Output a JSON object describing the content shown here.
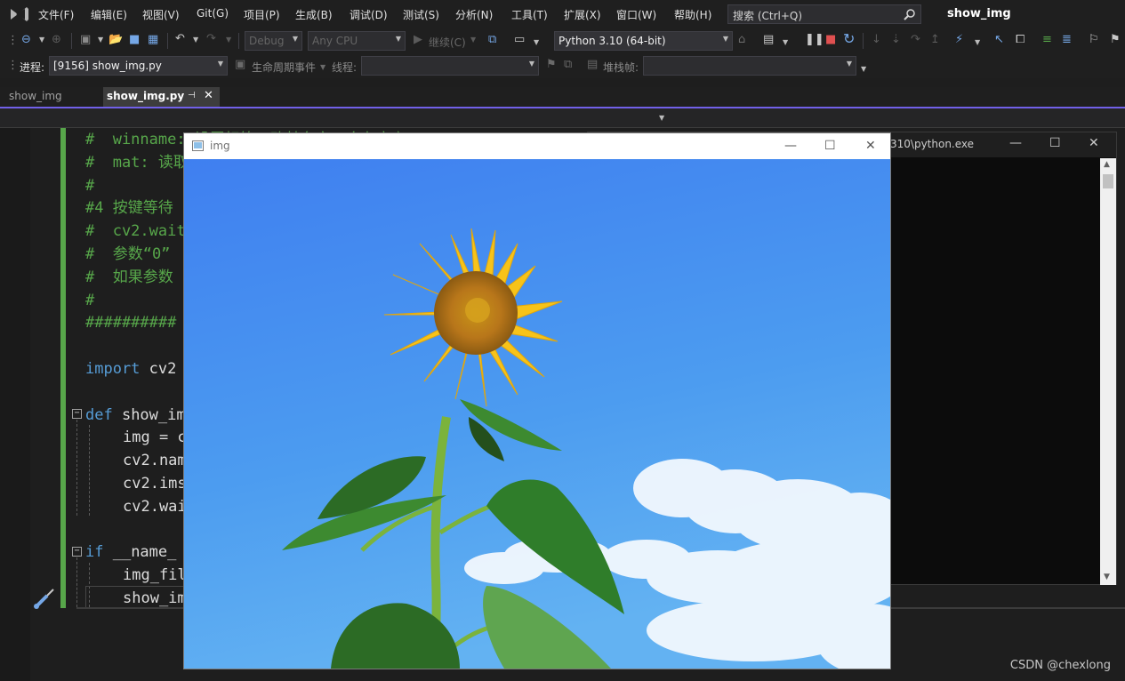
{
  "menubar": {
    "items": [
      "文件(F)",
      "编辑(E)",
      "视图(V)",
      "Git(G)",
      "项目(P)",
      "生成(B)",
      "调试(D)",
      "测试(S)",
      "分析(N)",
      "工具(T)",
      "扩展(X)",
      "窗口(W)",
      "帮助(H)"
    ],
    "search_placeholder": "搜索 (Ctrl+Q)",
    "app_title": "show_img"
  },
  "toolbar": {
    "config": "Debug",
    "platform": "Any CPU",
    "continue_label": "继续(C)",
    "environment": "Python 3.10 (64-bit)"
  },
  "debug_bar": {
    "process_label": "进程:",
    "process_value": "[9156] show_img.py",
    "lifecycle_label": "生命周期事件",
    "thread_label": "线程:",
    "stack_label": "堆栈帧:"
  },
  "tabs": [
    {
      "label": "show_img",
      "active": false
    },
    {
      "label": "show_img.py",
      "active": true
    }
  ],
  "code_lines": [
    {
      "indent": 0,
      "segments": [
        {
          "cls": "cmt",
          "text": "#  winname: 设置标签，改林名之一合在意义"
        }
      ]
    },
    {
      "indent": 0,
      "segments": [
        {
          "cls": "cmt",
          "text": "#  mat: 读取"
        }
      ]
    },
    {
      "indent": 0,
      "segments": [
        {
          "cls": "cmt",
          "text": "#"
        }
      ]
    },
    {
      "indent": 0,
      "segments": [
        {
          "cls": "cmt",
          "text": "#4 按键等待"
        }
      ]
    },
    {
      "indent": 0,
      "segments": [
        {
          "cls": "cmt",
          "text": "#  cv2.wait"
        }
      ]
    },
    {
      "indent": 0,
      "segments": [
        {
          "cls": "cmt",
          "text": "#  参数“0”"
        }
      ]
    },
    {
      "indent": 0,
      "segments": [
        {
          "cls": "cmt",
          "text": "#  如果参数"
        }
      ]
    },
    {
      "indent": 0,
      "segments": [
        {
          "cls": "cmt",
          "text": "#"
        }
      ]
    },
    {
      "indent": 0,
      "segments": [
        {
          "cls": "cmt",
          "text": "##########"
        }
      ]
    },
    {
      "indent": 0,
      "segments": []
    },
    {
      "indent": 0,
      "segments": [
        {
          "cls": "kw",
          "text": "import"
        },
        {
          "cls": "txt",
          "text": " cv2"
        }
      ]
    },
    {
      "indent": 0,
      "segments": []
    },
    {
      "indent": 0,
      "segments": [
        {
          "cls": "kw",
          "text": "def"
        },
        {
          "cls": "txt",
          "text": " show_im"
        }
      ]
    },
    {
      "indent": 1,
      "segments": [
        {
          "cls": "txt",
          "text": "img = c"
        }
      ]
    },
    {
      "indent": 1,
      "segments": [
        {
          "cls": "txt",
          "text": "cv2.nam"
        }
      ]
    },
    {
      "indent": 1,
      "segments": [
        {
          "cls": "txt",
          "text": "cv2.ims"
        }
      ]
    },
    {
      "indent": 1,
      "segments": [
        {
          "cls": "txt",
          "text": "cv2.wai"
        }
      ]
    },
    {
      "indent": 0,
      "segments": []
    },
    {
      "indent": 0,
      "segments": [
        {
          "cls": "kw",
          "text": "if"
        },
        {
          "cls": "txt",
          "text": " __name_"
        }
      ]
    },
    {
      "indent": 1,
      "segments": [
        {
          "cls": "txt",
          "text": "img_fil"
        }
      ]
    },
    {
      "indent": 1,
      "segments": [
        {
          "cls": "txt",
          "text": "show_im"
        }
      ]
    }
  ],
  "console_window": {
    "title": "310\\python.exe"
  },
  "img_window": {
    "title": "img"
  },
  "watermark": "CSDN @chexlong",
  "colors": {
    "accent": "#7160e8",
    "change_bar": "#57a64a",
    "comment": "#57a64a",
    "keyword": "#569cd6",
    "sky_top": "#3c82f0",
    "sky_bottom": "#5aacf2",
    "petal": "#f7c319",
    "leaf": "#2f7d2a"
  }
}
